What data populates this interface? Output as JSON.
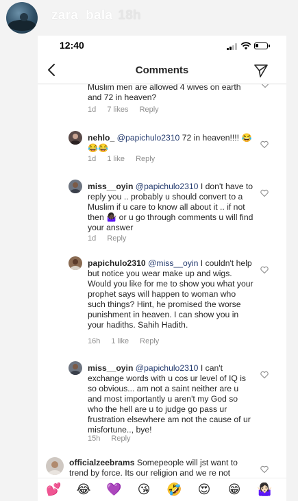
{
  "story": {
    "username": "zara_bala",
    "time": "18h"
  },
  "status_bar": {
    "time": "12:40"
  },
  "nav": {
    "title": "Comments"
  },
  "comments": [
    {
      "username": "",
      "text": "Muslim men are allowed 4 wives on earth and 72 in heaven?",
      "time": "1d",
      "likes": "7 likes",
      "reply": "Reply"
    },
    {
      "username": "nehlo_",
      "mention": "@papichulo2310",
      "text": " 72 in heaven!!!! 😂😂😂",
      "time": "1d",
      "likes": "1 like",
      "reply": "Reply"
    },
    {
      "username": "miss__oyin",
      "mention": "@papichulo2310",
      "text": " I don't have to reply you .. probably u should convert to a Muslim if u care to know all about it .. if not then 🤷🏿‍♀️ or u go through comments u will find your answer",
      "time": "1d",
      "likes": "",
      "reply": "Reply"
    },
    {
      "username": "papichulo2310",
      "mention": "@miss__oyin",
      "text": " I couldn't help but notice you wear make up and wigs. Would you like for me to show you what your prophet says will happen to woman who such things? Hint, he promised the worse punishment in heaven. I can show you in your hadiths. Sahih Hadith.",
      "time": "16h",
      "likes": "1 like",
      "reply": "Reply"
    },
    {
      "username": "miss__oyin",
      "mention": "@papichulo2310",
      "text": " I can't exchange words with u cos ur level of IQ is so obvious... am not a saint neither are u and most importantly u aren't my God so who the hell are u to judge go pass ur frustration elsewhere am not the cause of ur misfortune.., bye!",
      "time": "15h",
      "likes": "",
      "reply": "Reply"
    },
    {
      "username": "officialzeebrams",
      "mention": "",
      "text": " Somepeople will jst want to trend by force. Its our religion and we re not",
      "time": "",
      "likes": "",
      "reply": ""
    }
  ],
  "emoji_bar": [
    "💕",
    "😂",
    "💜",
    "😘",
    "🤣",
    "😍",
    "😁",
    "🤷🏻‍♀️"
  ],
  "colors": {
    "mention": "#233a6e",
    "meta": "#8e8e8e",
    "text": "#262626"
  }
}
